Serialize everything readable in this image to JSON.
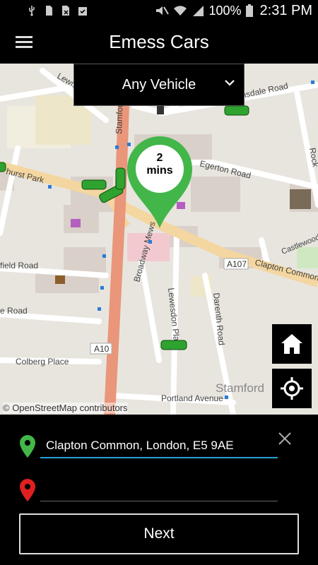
{
  "status_bar": {
    "battery_percent": "100%",
    "time": "2:31 PM"
  },
  "app_bar": {
    "title": "Emess Cars"
  },
  "vehicle_filter": {
    "selected": "Any Vehicle"
  },
  "map": {
    "eta": {
      "value": "2",
      "unit": "mins"
    },
    "labels": {
      "stamford_hill": "Stamford",
      "ravensdale": "Ravensdale Road",
      "egerton": "Egerton Road",
      "lewis": "Lewis Gardens",
      "hurst_park": "hurst Park",
      "a107": "A107",
      "clapton": "Clapton Common",
      "castlewood": "Castlewood",
      "broadway": "Broadway Mews",
      "lewesdon": "Lewesdon Place",
      "darenth": "Darenth Road",
      "fairfield": "field Road",
      "road": "e Road",
      "colberg": "Colberg Place",
      "a10": "A10",
      "portland": "Portland Avenue",
      "stamford_area": "Stamford",
      "rock": "Rock"
    },
    "attribution": "© OpenStreetMap contributors"
  },
  "pickup": {
    "value": "Clapton Common, London, E5 9AE"
  },
  "dropoff": {
    "value": ""
  },
  "next_button": {
    "label": "Next"
  },
  "colors": {
    "accent_green": "#43b649",
    "pin_red": "#e02020",
    "field_underline": "#2aa0d6",
    "main_road": "#e9967a",
    "secondary_road": "#f4d6a0"
  }
}
